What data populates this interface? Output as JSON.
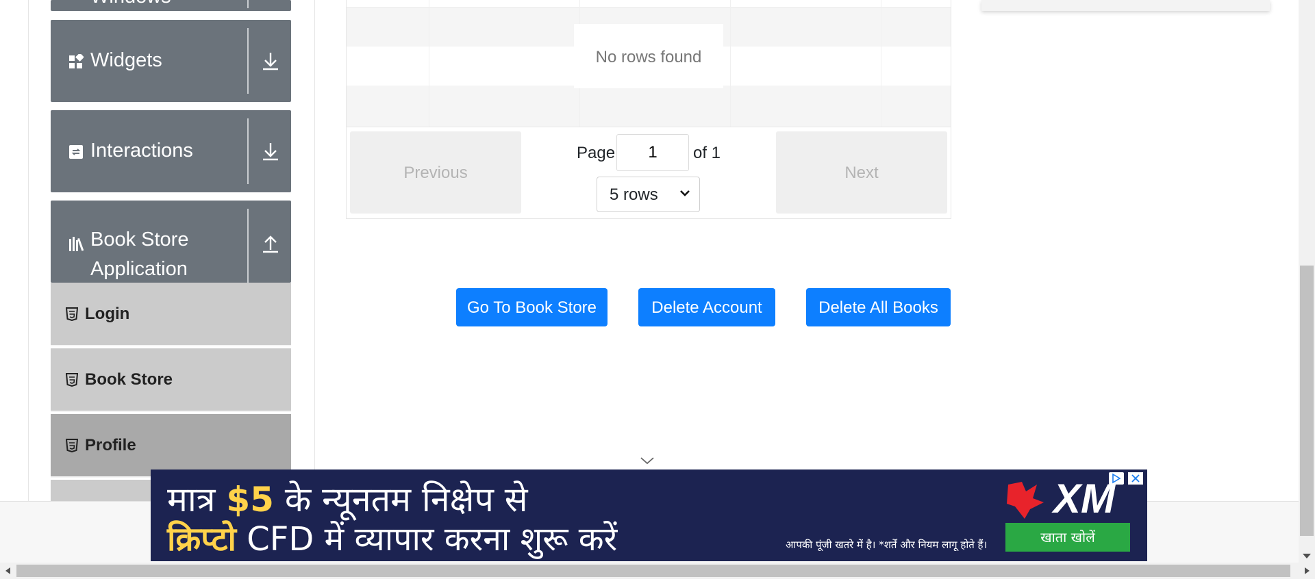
{
  "sidebar": {
    "partial_group_label": "Windows",
    "groups": [
      {
        "label": "Widgets",
        "icon": "widgets-icon",
        "arrow": "arrow-down-icon"
      },
      {
        "label": "Interactions",
        "icon": "interactions-icon",
        "arrow": "arrow-down-icon"
      },
      {
        "label_line1": "Book Store",
        "label_line2": "Application",
        "icon": "books-icon",
        "arrow": "arrow-up-icon"
      }
    ],
    "items": [
      {
        "label": "Login",
        "icon": "html5-icon"
      },
      {
        "label": "Book Store",
        "icon": "html5-icon"
      },
      {
        "label": "Profile",
        "icon": "html5-icon",
        "active": true
      }
    ]
  },
  "table": {
    "empty_message": "No rows found"
  },
  "pagination": {
    "previous_label": "Previous",
    "next_label": "Next",
    "page_label": "Page",
    "page_value": "1",
    "of_label": "of 1",
    "rows_selected": "5 rows"
  },
  "actions": {
    "go_to_store": "Go To Book Store",
    "delete_account": "Delete Account",
    "delete_all_books": "Delete All Books"
  },
  "ad": {
    "line1_part1": "मात्र ",
    "line1_highlight": "$5",
    "line1_part2": " के न्यूनतम निक्षेप से",
    "line2_highlight": "क्रिप्टो",
    "line2_part2": " CFD में  व्यापार करना शुरू करें",
    "brand": "XM",
    "cta": "खाता खोलें",
    "disclaimer": "आपकी पूंजी खतरे में है। *शर्तें और नियम लागू होते हैं।"
  },
  "colors": {
    "primary_button": "#0d7fff",
    "sidebar_group": "#6b737b",
    "sidebar_item": "#cbcbcb",
    "sidebar_item_active": "#a9a9a9",
    "ad_background": "#1c2351",
    "ad_cta": "#2aa844"
  }
}
